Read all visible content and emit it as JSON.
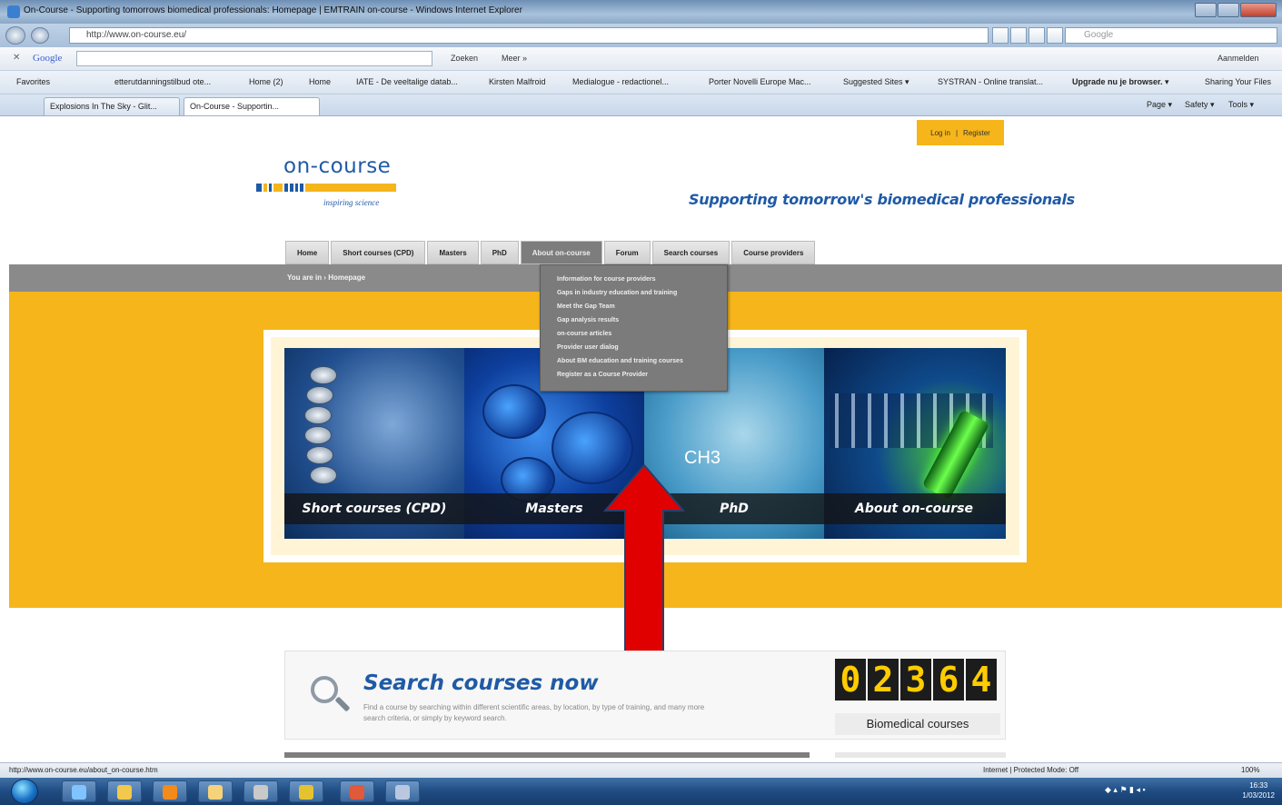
{
  "window": {
    "title": "On-Course - Supporting tomorrows biomedical professionals: Homepage | EMTRAIN on-course - Windows Internet Explorer"
  },
  "addressbar": {
    "url": "http://www.on-course.eu/",
    "search_placeholder": "Google"
  },
  "google_toolbar": {
    "logo": "Google",
    "search_button": "Zoeken",
    "more": "Meer »",
    "signin": "Aanmelden"
  },
  "favorites": {
    "label": "Favorites",
    "items": [
      "etterutdanningstilbud ote...",
      "Home (2)",
      "Home",
      "IATE - De veeltalige datab...",
      "Kirsten Malfroid",
      "Medialogue - redactionel...",
      "Porter Novelli Europe Mac...",
      "Suggested Sites ▾",
      "SYSTRAN - Online translat...",
      "Upgrade nu je browser. ▾",
      "Sharing Your Files"
    ]
  },
  "tabs": [
    {
      "label": "Explosions In The Sky - Glit..."
    },
    {
      "label": "On-Course - Supportin..."
    }
  ],
  "commandbar": {
    "page": "Page ▾",
    "safety": "Safety ▾",
    "tools": "Tools ▾"
  },
  "site": {
    "login": "Log in",
    "register": "Register",
    "logo": "on-course",
    "tagline": "inspiring science",
    "slogan": "Supporting tomorrow's biomedical professionals",
    "nav": [
      {
        "label": "Home"
      },
      {
        "label": "Short courses (CPD)"
      },
      {
        "label": "Masters"
      },
      {
        "label": "PhD"
      },
      {
        "label": "About on-course"
      },
      {
        "label": "Forum"
      },
      {
        "label": "Search courses"
      },
      {
        "label": "Course providers"
      }
    ],
    "breadcrumb": "You are in  ›  Homepage",
    "dropdown": [
      "Information for course providers",
      "Gaps in industry education and training",
      "Meet the Gap Team",
      "Gap analysis results",
      "on-course articles",
      "Provider user dialog",
      "About BM education and training courses",
      "Register as a Course Provider"
    ],
    "hero_labels": [
      "Short courses (CPD)",
      "Masters",
      "PhD",
      "About on-course"
    ],
    "hero_formula": "CH3",
    "search_title": "Search courses now",
    "search_desc": "Find a course by searching within different scientific areas, by location, by type of training, and many more search criteria, or simply by keyword search.",
    "counter_digits": [
      "0",
      "2",
      "3",
      "6",
      "4"
    ],
    "counter_label": "Biomedical courses"
  },
  "statusbar": {
    "url": "http://www.on-course.eu/about_on-course.htm",
    "zone": "Internet | Protected Mode: Off",
    "zoom": "100%"
  },
  "taskbar": {
    "time": "16:33",
    "date": "1/03/2012"
  },
  "colors": {
    "brand_blue": "#1f5aa6",
    "brand_yellow": "#f5b51b",
    "nav_grey": "#8a8a8a",
    "arrow_red": "#e10000"
  }
}
